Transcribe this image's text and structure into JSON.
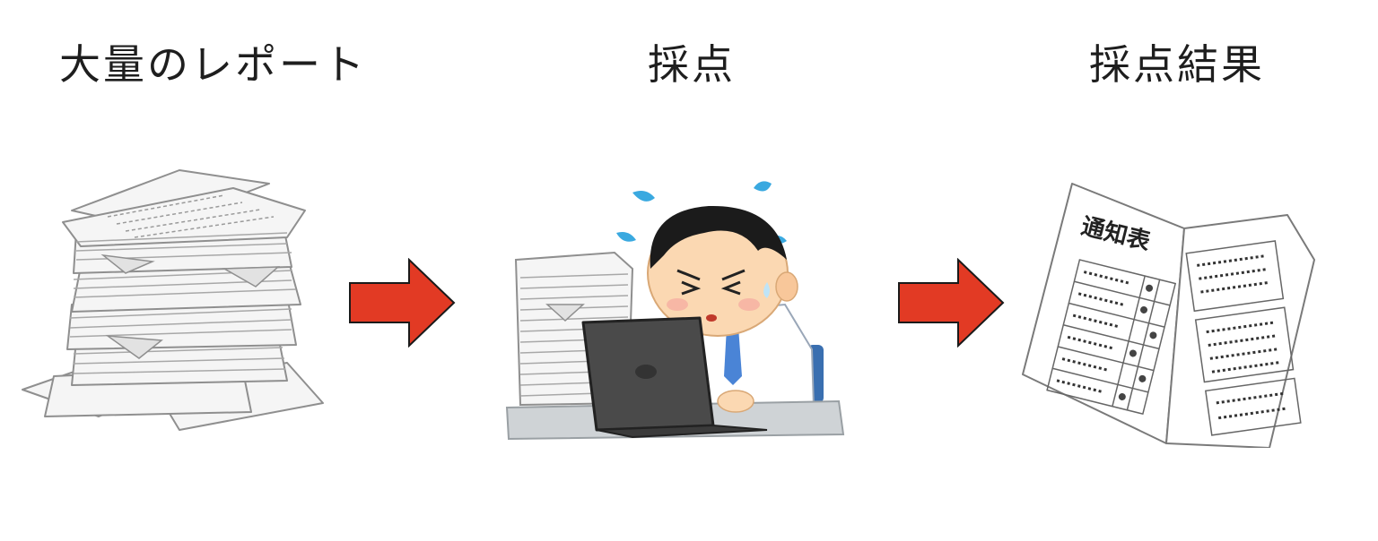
{
  "labels": {
    "step1": "大量のレポート",
    "step2": "採点",
    "step3": "採点結果"
  },
  "report_card": {
    "title": "通知表"
  },
  "colors": {
    "arrow_fill": "#e23a24",
    "arrow_stroke": "#1a1a1a",
    "paper_fill": "#f4f4f4",
    "paper_line": "#9a9a9a",
    "laptop": "#4a4a4a",
    "sweat": "#3aa9e0"
  },
  "icons": [
    "paper-stack-icon",
    "arrow-right-icon",
    "stressed-office-worker-icon",
    "report-card-icon"
  ]
}
